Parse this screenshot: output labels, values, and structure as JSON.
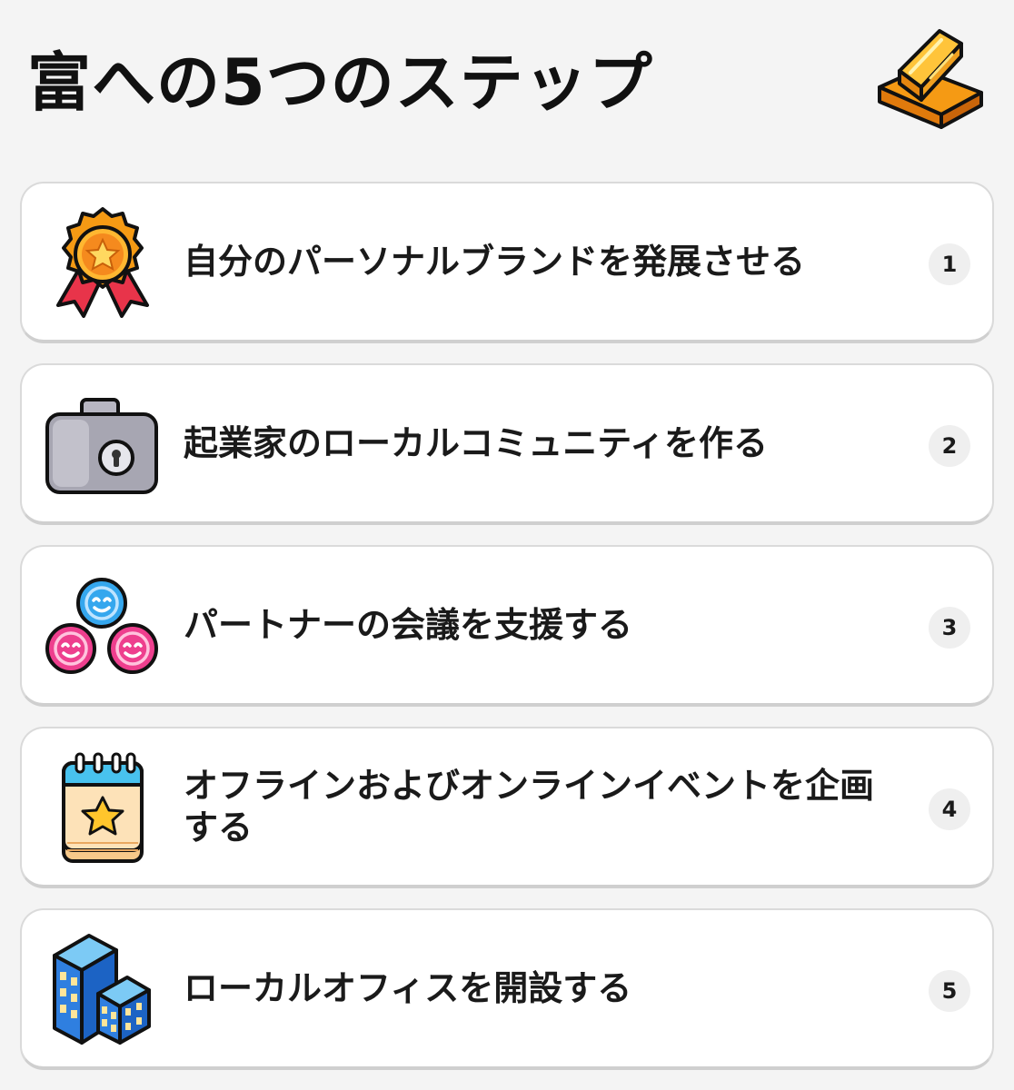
{
  "header": {
    "title": "富への5つのステップ",
    "icon": "gold-bars-icon"
  },
  "steps": [
    {
      "label": "自分のパーソナルブランドを発展させる",
      "number": "1",
      "icon": "medal-icon"
    },
    {
      "label": "起業家のローカルコミュニティを作る",
      "number": "2",
      "icon": "briefcase-icon"
    },
    {
      "label": "パートナーの会議を支援する",
      "number": "3",
      "icon": "people-group-icon"
    },
    {
      "label": "オフラインおよびオンラインイベントを企画する",
      "number": "4",
      "icon": "calendar-icon"
    },
    {
      "label": "ローカルオフィスを開設する",
      "number": "5",
      "icon": "office-buildings-icon"
    }
  ],
  "colors": {
    "background": "#f4f4f4",
    "card": "#ffffff",
    "gold": "#f7a51c",
    "medal_ribbon": "#e8344a",
    "briefcase": "#a7a6b2",
    "face_blue": "#35a7ee",
    "face_pink": "#ee3f8e",
    "building": "#2f7fe0"
  }
}
